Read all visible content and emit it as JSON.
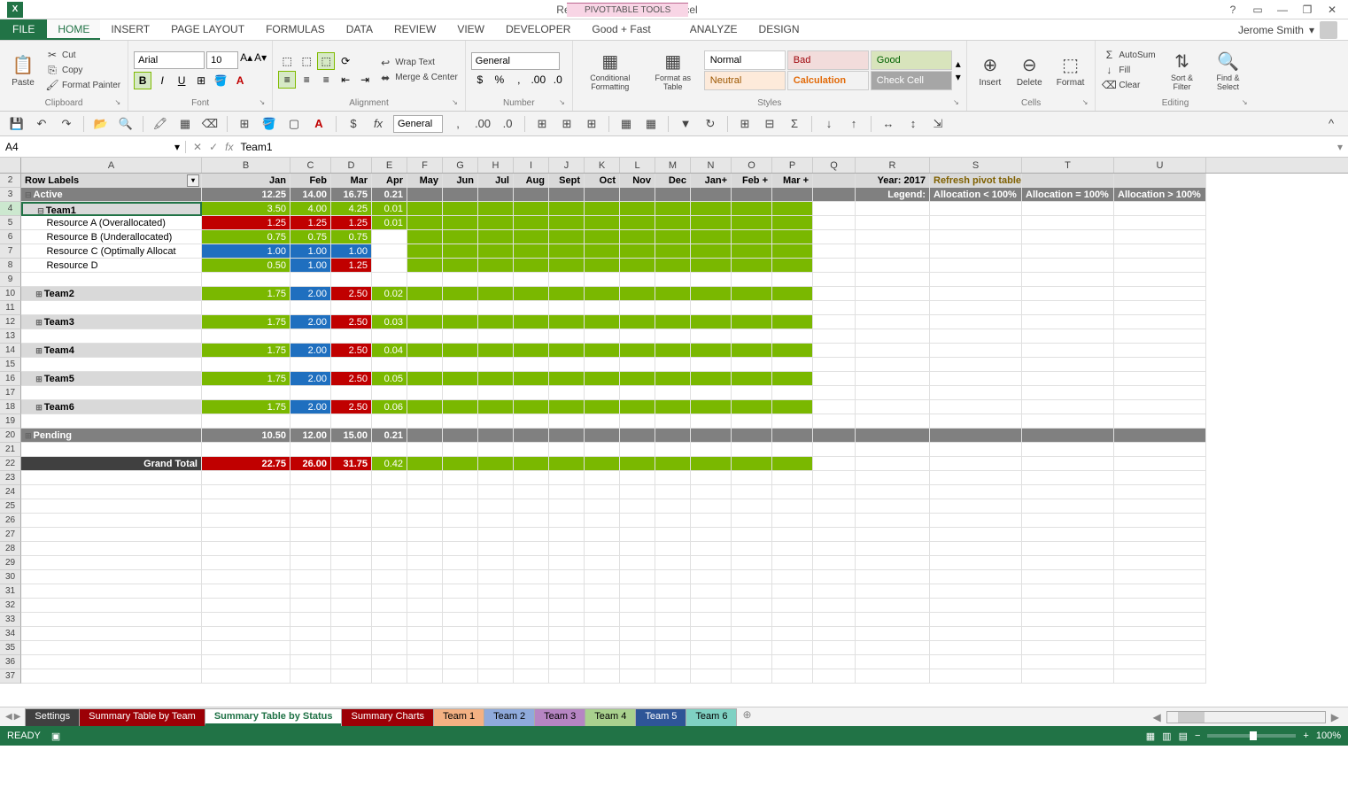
{
  "titlebar": {
    "title": "Resource Planner.xlsx - Excel",
    "pivot_tools": "PIVOTTABLE TOOLS"
  },
  "user": "Jerome Smith",
  "tabs": {
    "file": "FILE",
    "home": "HOME",
    "insert": "INSERT",
    "page_layout": "PAGE LAYOUT",
    "formulas": "FORMULAS",
    "data": "DATA",
    "review": "REVIEW",
    "view": "VIEW",
    "developer": "DEVELOPER",
    "goodfast": "Good + Fast",
    "analyze": "ANALYZE",
    "design": "DESIGN"
  },
  "ribbon": {
    "clipboard": {
      "label": "Clipboard",
      "paste": "Paste",
      "cut": "Cut",
      "copy": "Copy",
      "format_painter": "Format Painter"
    },
    "font": {
      "label": "Font",
      "name": "Arial",
      "size": "10"
    },
    "alignment": {
      "label": "Alignment",
      "wrap": "Wrap Text",
      "merge": "Merge & Center"
    },
    "number": {
      "label": "Number",
      "format": "General"
    },
    "styles": {
      "label": "Styles",
      "cond": "Conditional Formatting",
      "table": "Format as Table",
      "normal": "Normal",
      "bad": "Bad",
      "good": "Good",
      "neutral": "Neutral",
      "calc": "Calculation",
      "check": "Check Cell"
    },
    "cells": {
      "label": "Cells",
      "insert": "Insert",
      "delete": "Delete",
      "format": "Format"
    },
    "editing": {
      "label": "Editing",
      "autosum": "AutoSum",
      "fill": "Fill",
      "clear": "Clear",
      "sort": "Sort & Filter",
      "find": "Find & Select"
    }
  },
  "qat_general": "General",
  "name_box": "A4",
  "formula": "Team1",
  "columns": [
    "A",
    "B",
    "C",
    "D",
    "E",
    "F",
    "G",
    "H",
    "I",
    "J",
    "K",
    "L",
    "M",
    "N",
    "O",
    "P",
    "Q",
    "R",
    "S",
    "T",
    "U"
  ],
  "months": [
    "Jan",
    "Feb",
    "Mar",
    "Apr",
    "May",
    "Jun",
    "Jul",
    "Aug",
    "Sept",
    "Oct",
    "Nov",
    "Dec",
    "Jan+",
    "Feb +",
    "Mar +"
  ],
  "row_labels_header": "Row Labels",
  "year": "Year: 2017",
  "refresh_note": "Refresh pivot table by going to Data >> Refresh All",
  "legend": {
    "label": "Legend:",
    "under": "Allocation < 100%",
    "equal": "Allocation = 100%",
    "over": "Allocation > 100%"
  },
  "grid": {
    "active": {
      "label": "Active",
      "vals": [
        "12.25",
        "14.00",
        "16.75",
        "0.21"
      ]
    },
    "team1": {
      "label": "Team1",
      "vals": [
        "3.50",
        "4.00",
        "4.25",
        "0.01"
      ],
      "colors": [
        "green",
        "green",
        "green",
        "green"
      ]
    },
    "resA": {
      "label": "Resource A (Overallocated)",
      "vals": [
        "1.25",
        "1.25",
        "1.25",
        "0.01"
      ],
      "colors": [
        "red",
        "red",
        "red",
        "green"
      ]
    },
    "resB": {
      "label": "Resource B (Underallocated)",
      "vals": [
        "0.75",
        "0.75",
        "0.75",
        ""
      ],
      "colors": [
        "green",
        "green",
        "green",
        ""
      ]
    },
    "resC": {
      "label": "Resource C (Optimally Allocat",
      "vals": [
        "1.00",
        "1.00",
        "1.00",
        ""
      ],
      "colors": [
        "blue",
        "blue",
        "blue",
        ""
      ]
    },
    "resD": {
      "label": "Resource D",
      "vals": [
        "0.50",
        "1.00",
        "1.25",
        ""
      ],
      "colors": [
        "green",
        "blue",
        "red",
        ""
      ]
    },
    "team2": {
      "label": "Team2",
      "vals": [
        "1.75",
        "2.00",
        "2.50",
        "0.02"
      ],
      "colors": [
        "green",
        "blue",
        "red",
        "green"
      ]
    },
    "team3": {
      "label": "Team3",
      "vals": [
        "1.75",
        "2.00",
        "2.50",
        "0.03"
      ],
      "colors": [
        "green",
        "blue",
        "red",
        "green"
      ]
    },
    "team4": {
      "label": "Team4",
      "vals": [
        "1.75",
        "2.00",
        "2.50",
        "0.04"
      ],
      "colors": [
        "green",
        "blue",
        "red",
        "green"
      ]
    },
    "team5": {
      "label": "Team5",
      "vals": [
        "1.75",
        "2.00",
        "2.50",
        "0.05"
      ],
      "colors": [
        "green",
        "blue",
        "red",
        "green"
      ]
    },
    "team6": {
      "label": "Team6",
      "vals": [
        "1.75",
        "2.00",
        "2.50",
        "0.06"
      ],
      "colors": [
        "green",
        "blue",
        "red",
        "green"
      ]
    },
    "pending": {
      "label": "Pending",
      "vals": [
        "10.50",
        "12.00",
        "15.00",
        "0.21"
      ]
    },
    "total": {
      "label": "Grand Total",
      "vals": [
        "22.75",
        "26.00",
        "31.75",
        "0.42"
      ]
    }
  },
  "sheets": {
    "settings": "Settings",
    "team": "Summary Table by Team",
    "status": "Summary Table by Status",
    "charts": "Summary Charts",
    "t1": "Team 1",
    "t2": "Team 2",
    "t3": "Team 3",
    "t4": "Team 4",
    "t5": "Team 5",
    "t6": "Team 6"
  },
  "status": {
    "ready": "READY",
    "zoom": "100%"
  }
}
